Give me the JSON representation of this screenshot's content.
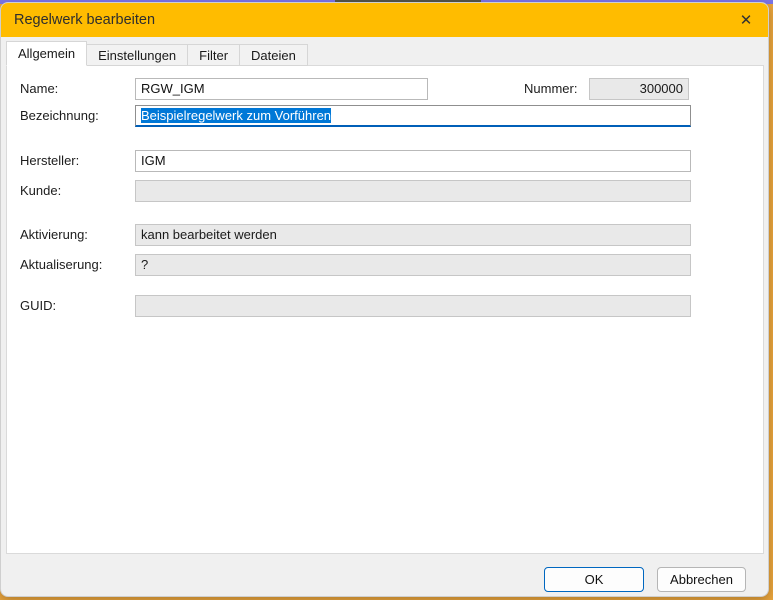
{
  "window": {
    "title": "Regelwerk bearbeiten",
    "close_glyph": "✕"
  },
  "tabs": [
    {
      "label": "Allgemein",
      "active": true
    },
    {
      "label": "Einstellungen",
      "active": false
    },
    {
      "label": "Filter",
      "active": false
    },
    {
      "label": "Dateien",
      "active": false
    }
  ],
  "form": {
    "name": {
      "label": "Name:",
      "value": "RGW_IGM"
    },
    "nummer": {
      "label": "Nummer:",
      "value": "300000"
    },
    "bezeichnung": {
      "label": "Bezeichnung:",
      "value": "Beispielregelwerk zum Vorführen",
      "selected": true,
      "focused": true
    },
    "hersteller": {
      "label": "Hersteller:",
      "value": "IGM"
    },
    "kunde": {
      "label": "Kunde:",
      "value": "",
      "disabled": true
    },
    "aktivierung": {
      "label": "Aktivierung:",
      "value": "kann bearbeitet werden",
      "disabled": true
    },
    "aktualiserung": {
      "label": "Aktualiserung:",
      "value": "?",
      "disabled": true
    },
    "guid": {
      "label": "GUID:",
      "value": "",
      "disabled": true
    }
  },
  "buttons": {
    "ok": "OK",
    "cancel": "Abbrechen"
  },
  "colors": {
    "titlebar": "#ffbc00",
    "dialog_bg": "#f0f0f0",
    "page_bg": "#ffffff",
    "focus_underline": "#005fb8",
    "selection": "#0078d7",
    "disabled_field_bg": "#e9e9e9",
    "ok_border": "#0067c0",
    "background_orange": "#e9a43c",
    "background_purple": "#7b74e6"
  }
}
